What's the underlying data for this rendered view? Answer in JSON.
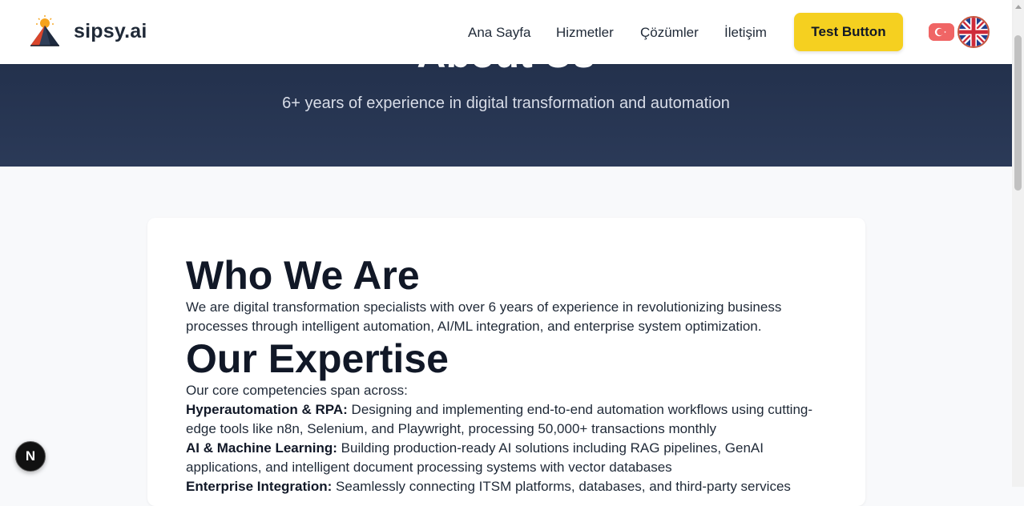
{
  "brand": {
    "name": "sipsy.ai",
    "logo_icon": "pyramid-sun-icon"
  },
  "nav": {
    "items": [
      {
        "label": "Ana Sayfa"
      },
      {
        "label": "Hizmetler"
      },
      {
        "label": "Çözümler"
      },
      {
        "label": "İletişim"
      }
    ],
    "cta_label": "Test Button",
    "languages": [
      {
        "code": "tr",
        "icon": "turkey-flag-icon"
      },
      {
        "code": "en",
        "icon": "uk-flag-icon",
        "selected": true
      }
    ]
  },
  "hero": {
    "title": "About Us",
    "subtitle": "6+ years of experience in digital transformation and automation"
  },
  "sections": {
    "who": {
      "heading": "Who We Are",
      "text": "We are digital transformation specialists with over 6 years of experience in revolutionizing business processes through intelligent automation, AI/ML integration, and enterprise system optimization."
    },
    "expertise": {
      "heading": "Our Expertise",
      "intro": "Our core competencies span across:",
      "items": [
        {
          "title": "Hyperautomation & RPA:",
          "text": "Designing and implementing end-to-end automation workflows using cutting-edge tools like n8n, Selenium, and Playwright, processing 50,000+ transactions monthly"
        },
        {
          "title": "AI & Machine Learning:",
          "text": "Building production-ready AI solutions including RAG pipelines, GenAI applications, and intelligent document processing systems with vector databases"
        },
        {
          "title": "Enterprise Integration:",
          "text": "Seamlessly connecting ITSM platforms, databases, and third-party services"
        }
      ]
    }
  },
  "floating_badge": {
    "label": "N"
  },
  "colors": {
    "accent": "#f5d020",
    "hero_bg": "#263450",
    "text_dark": "#111827"
  }
}
